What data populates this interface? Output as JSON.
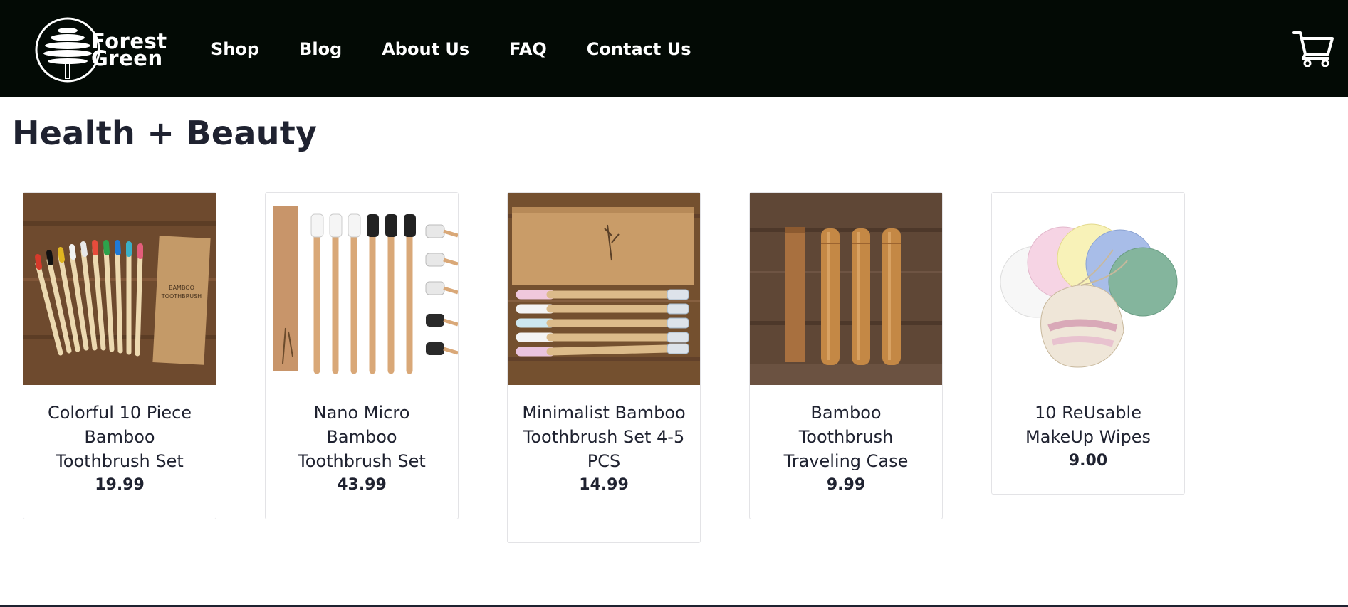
{
  "brand": {
    "line1": "Forest",
    "line2": "Green"
  },
  "nav": [
    "Shop",
    "Blog",
    "About Us",
    "FAQ",
    "Contact Us"
  ],
  "page_title": "Health + Beauty",
  "products": [
    {
      "name": "Colorful 10 Piece Bamboo Toothbrush Set",
      "price": "19.99"
    },
    {
      "name": "Nano Micro Bamboo Toothbrush Set",
      "price": "43.99"
    },
    {
      "name": "Minimalist Bamboo Toothbrush Set 4-5 PCS",
      "price": "14.99"
    },
    {
      "name": "Bamboo Toothbrush Traveling Case",
      "price": "9.99"
    },
    {
      "name": "10 ReUsable MakeUp Wipes",
      "price": "9.00"
    }
  ],
  "colors": {
    "header_bg": "#030a05",
    "text": "#1f2230",
    "wood": "#7a5233",
    "kraft": "#c89a66"
  },
  "icons": [
    "tree-logo-icon",
    "cart-icon"
  ]
}
